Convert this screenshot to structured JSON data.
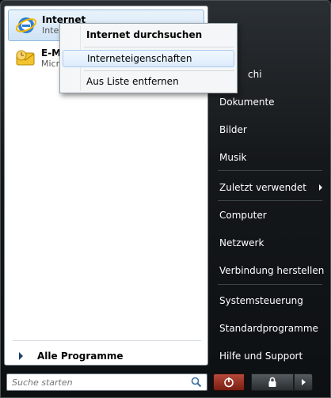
{
  "pinned": [
    {
      "title": "Internet",
      "subtitle": "Internet Explorer",
      "icon": "internet-explorer-icon"
    },
    {
      "title": "E-Mail",
      "subtitle": "Microsoft Office Outlook",
      "icon": "outlook-mail-icon"
    }
  ],
  "all_programs_label": "Alle Programme",
  "search": {
    "placeholder": "Suche starten"
  },
  "right_items": [
    {
      "label": "Dokumente"
    },
    {
      "label": "Bilder"
    },
    {
      "label": "Musik"
    },
    {
      "label": "Zuletzt verwendet"
    },
    {
      "label": "Computer"
    },
    {
      "label": "Netzwerk"
    },
    {
      "label": "Verbindung herstellen"
    },
    {
      "label": "Systemsteuerung"
    },
    {
      "label": "Standardprogramme"
    },
    {
      "label": "Hilfe und Support"
    }
  ],
  "user_label_fragment": "chi",
  "context_menu": {
    "items": [
      {
        "label": "Internet durchsuchen"
      },
      {
        "label": "Interneteigenschaften"
      },
      {
        "label": "Aus Liste entfernen"
      }
    ]
  },
  "colors": {
    "highlight": "#cfe3f5",
    "power_button": "#9e2a1c",
    "pane_dark": "#15181b"
  }
}
